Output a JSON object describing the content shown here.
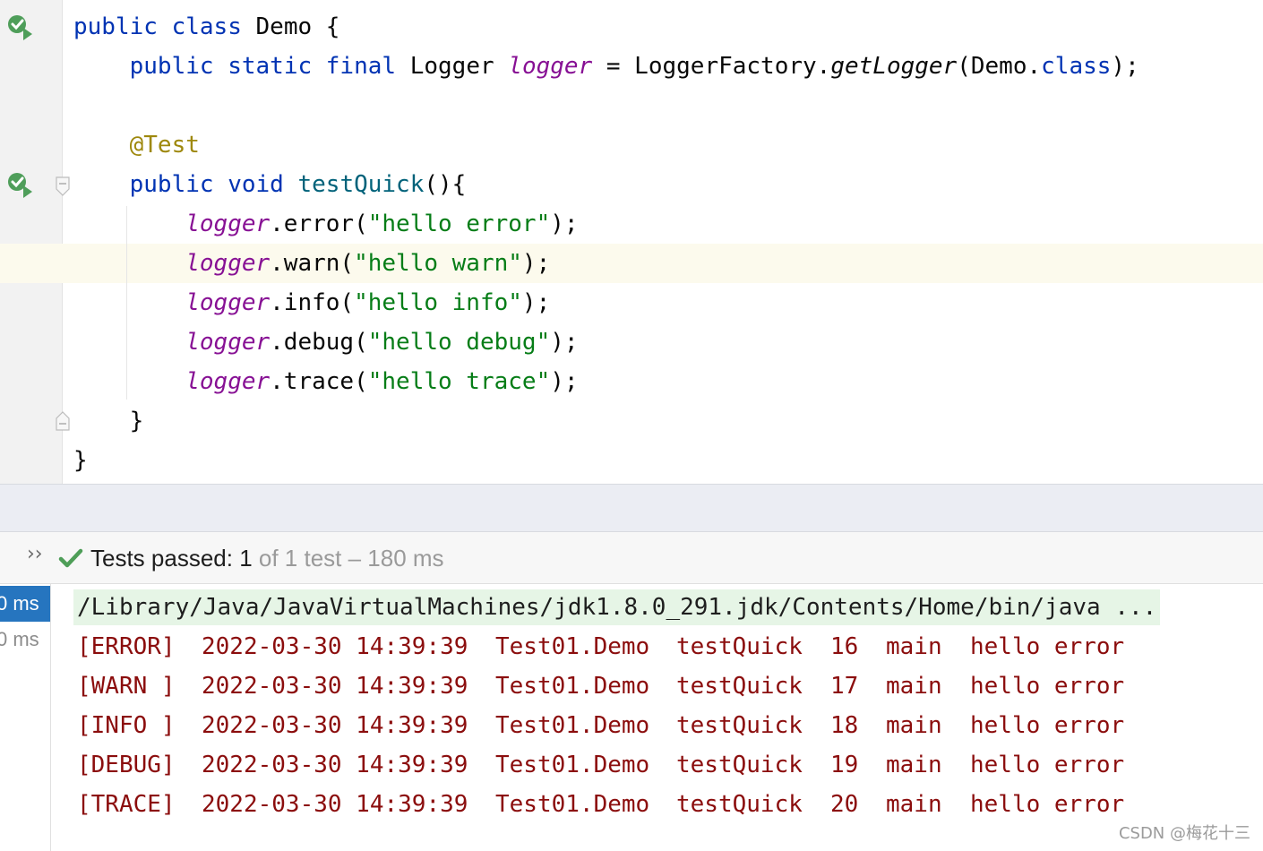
{
  "editor": {
    "lines": [
      [
        {
          "t": "public",
          "c": "kw"
        },
        {
          "t": " "
        },
        {
          "t": "class",
          "c": "kw"
        },
        {
          "t": " Demo {"
        }
      ],
      [
        {
          "t": "    "
        },
        {
          "t": "public",
          "c": "kw"
        },
        {
          "t": " "
        },
        {
          "t": "static",
          "c": "kw"
        },
        {
          "t": " "
        },
        {
          "t": "final",
          "c": "kw"
        },
        {
          "t": " Logger "
        },
        {
          "t": "logger",
          "c": "fld"
        },
        {
          "t": " = LoggerFactory."
        },
        {
          "t": "getLogger",
          "c": "itl"
        },
        {
          "t": "(Demo."
        },
        {
          "t": "class",
          "c": "kw"
        },
        {
          "t": ");"
        }
      ],
      [],
      [
        {
          "t": "    "
        },
        {
          "t": "@Test",
          "c": "ann"
        }
      ],
      [
        {
          "t": "    "
        },
        {
          "t": "public",
          "c": "kw"
        },
        {
          "t": " "
        },
        {
          "t": "void",
          "c": "kw"
        },
        {
          "t": " "
        },
        {
          "t": "testQuick",
          "c": "mth"
        },
        {
          "t": "(){"
        }
      ],
      [
        {
          "t": "        "
        },
        {
          "t": "logger",
          "c": "fld"
        },
        {
          "t": ".error("
        },
        {
          "t": "\"hello error\"",
          "c": "str"
        },
        {
          "t": ");"
        }
      ],
      [
        {
          "t": "        "
        },
        {
          "t": "logger",
          "c": "fld"
        },
        {
          "t": ".warn("
        },
        {
          "t": "\"hello warn\"",
          "c": "str"
        },
        {
          "t": ");"
        }
      ],
      [
        {
          "t": "        "
        },
        {
          "t": "logger",
          "c": "fld"
        },
        {
          "t": ".info("
        },
        {
          "t": "\"hello info\"",
          "c": "str"
        },
        {
          "t": ");"
        }
      ],
      [
        {
          "t": "        "
        },
        {
          "t": "logger",
          "c": "fld"
        },
        {
          "t": ".debug("
        },
        {
          "t": "\"hello debug\"",
          "c": "str"
        },
        {
          "t": ");"
        }
      ],
      [
        {
          "t": "        "
        },
        {
          "t": "logger",
          "c": "fld"
        },
        {
          "t": ".trace("
        },
        {
          "t": "\"hello trace\"",
          "c": "str"
        },
        {
          "t": ");"
        }
      ],
      [
        {
          "t": "    }"
        }
      ],
      [
        {
          "t": "}"
        }
      ]
    ]
  },
  "test_bar": {
    "chevron": "››",
    "passed_label": "Tests passed: 1",
    "passed_rest": " of 1 test – 180 ms"
  },
  "tree": {
    "rows": [
      "0 ms",
      "0 ms"
    ]
  },
  "console": {
    "java_path": "/Library/Java/JavaVirtualMachines/jdk1.8.0_291.jdk/Contents/Home/bin/java ...",
    "logs": [
      {
        "level": "[ERROR]",
        "time": "2022-03-30 14:39:39",
        "cls": "Test01.Demo",
        "method": "testQuick",
        "line": "16",
        "thread": "main",
        "msg": "hello error"
      },
      {
        "level": "[WARN ]",
        "time": "2022-03-30 14:39:39",
        "cls": "Test01.Demo",
        "method": "testQuick",
        "line": "17",
        "thread": "main",
        "msg": "hello error"
      },
      {
        "level": "[INFO ]",
        "time": "2022-03-30 14:39:39",
        "cls": "Test01.Demo",
        "method": "testQuick",
        "line": "18",
        "thread": "main",
        "msg": "hello error"
      },
      {
        "level": "[DEBUG]",
        "time": "2022-03-30 14:39:39",
        "cls": "Test01.Demo",
        "method": "testQuick",
        "line": "19",
        "thread": "main",
        "msg": "hello error"
      },
      {
        "level": "[TRACE]",
        "time": "2022-03-30 14:39:39",
        "cls": "Test01.Demo",
        "method": "testQuick",
        "line": "20",
        "thread": "main",
        "msg": "hello error"
      }
    ]
  },
  "watermark": "CSDN @梅花十三",
  "colors": {
    "keyword": "#0033b3",
    "field": "#871094",
    "annotation": "#9e880d",
    "string": "#067d17",
    "log_text": "#8b0d0d",
    "selection": "#2675bf"
  }
}
